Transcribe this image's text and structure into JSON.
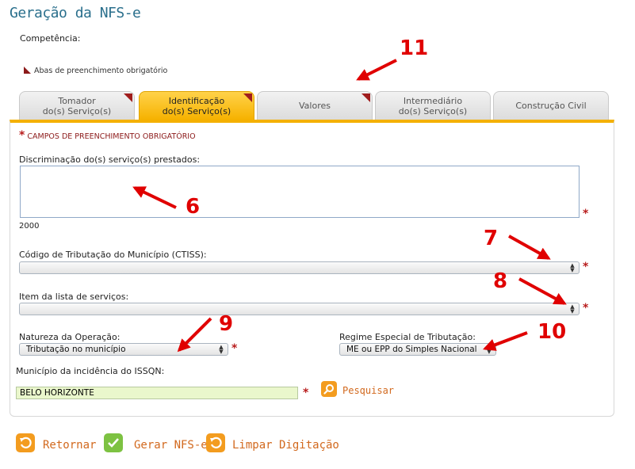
{
  "page": {
    "title": "Geração da NFS-e",
    "competencia_label": "Competência:",
    "legend": "Abas de preenchimento obrigatório",
    "required_note": "CAMPOS DE PREENCHIMENTO OBRIGATÓRIO",
    "required_star": "*"
  },
  "tabs": [
    {
      "label_line1": "Tomador",
      "label_line2": "do(s) Serviço(s)",
      "active": false,
      "required": true
    },
    {
      "label_line1": "Identificação",
      "label_line2": "do(s) Serviço(s)",
      "active": true,
      "required": true
    },
    {
      "label_line1": "Valores",
      "label_line2": "",
      "active": false,
      "required": true
    },
    {
      "label_line1": "Intermediário",
      "label_line2": "do(s) Serviço(s)",
      "active": false,
      "required": false
    },
    {
      "label_line1": "Construção Civil",
      "label_line2": "",
      "active": false,
      "required": false
    }
  ],
  "form": {
    "descricao_label": "Discriminação do(s) serviço(s) prestados:",
    "descricao_value": "",
    "descricao_counter": "2000",
    "ctiss_label": "Código de Tributação do Município (CTISS):",
    "ctiss_value": "",
    "item_label": "Item da lista de serviços:",
    "item_value": "",
    "natureza_label": "Natureza da Operação:",
    "natureza_value": "Tributação no município",
    "regime_label": "Regime Especial de Tributação:",
    "regime_value": "ME ou EPP do Simples Nacional",
    "municipio_label": "Município da incidência do ISSQN:",
    "municipio_value": "BELO HORIZONTE",
    "pesquisar_label": "Pesquisar"
  },
  "actions": {
    "retornar": "Retornar",
    "gerar": "Gerar NFS-e",
    "limpar": "Limpar Digitação"
  },
  "annotations": [
    "6",
    "7",
    "8",
    "9",
    "10",
    "11"
  ],
  "colors": {
    "accent": "#f4b000",
    "title": "#2a6f8c",
    "required": "#b81d1d",
    "annotation": "#e00000",
    "action_text": "#d2691e"
  }
}
